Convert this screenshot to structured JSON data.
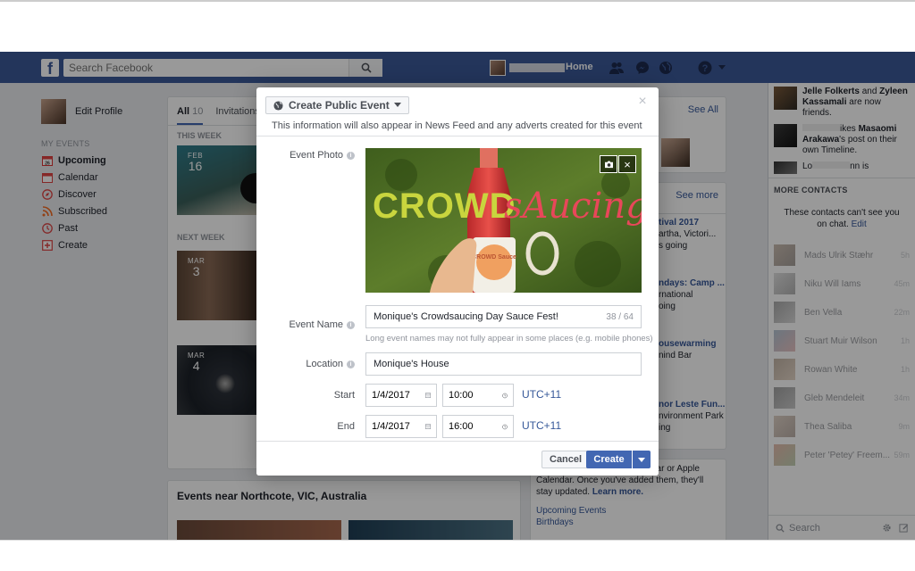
{
  "header": {
    "search_placeholder": "Search Facebook",
    "home": "Home"
  },
  "left_nav": {
    "edit_profile": "Edit Profile",
    "section": "MY EVENTS",
    "items": [
      {
        "label": "Upcoming",
        "icon": "calendar-26-icon"
      },
      {
        "label": "Calendar",
        "icon": "calendar-icon"
      },
      {
        "label": "Discover",
        "icon": "compass-icon"
      },
      {
        "label": "Subscribed",
        "icon": "rss-icon"
      },
      {
        "label": "Past",
        "icon": "clock-icon"
      },
      {
        "label": "Create",
        "icon": "plus-box-icon"
      }
    ],
    "calendar_day": "26"
  },
  "events": {
    "tab_all": "All",
    "tab_all_count": "10",
    "tab_invitations": "Invitations",
    "this_week": "THIS WEEK",
    "next_week": "NEXT WEEK",
    "cards": [
      {
        "month": "FEB",
        "day": "16"
      },
      {
        "month": "MAR",
        "day": "3"
      },
      {
        "month": "MAR",
        "day": "4"
      }
    ],
    "nearby_title": "Events near Northcote, VIC, Australia"
  },
  "right": {
    "see_all": "See All",
    "see_more": "See more",
    "snippets": [
      {
        "title": "tival 2017",
        "line1": "artha, Victori...",
        "line2": "s going"
      },
      {
        "title": "ndays: Camp ...",
        "line1": "rnational",
        "line2": "oing"
      },
      {
        "title": "ousewarming",
        "line1": "nind Bar",
        "line2": ""
      },
      {
        "title": "nor Leste Fun...",
        "line1": "nvironment Park",
        "line2": "ing"
      }
    ],
    "export_text": "rosoft Outlook, Google Calendar or Apple Calendar. Once you've added them, they'll stay updated.",
    "learn_more": "Learn more.",
    "upcoming_events": "Upcoming Events",
    "birthdays": "Birthdays"
  },
  "chat": {
    "notifs": [
      {
        "bold1": "Jelle Folkerts",
        "mid": " and ",
        "bold2": "Zyleen Kassamali",
        "rest": " are now friends."
      },
      {
        "bold1": "",
        "mid": "ikes ",
        "bold2": "Masaomi Arakawa",
        "rest": "'s post on their own Timeline."
      },
      {
        "bold1": "",
        "mid": "Lo",
        "bold2": "",
        "rest": "nn is"
      }
    ],
    "more_contacts": "MORE CONTACTS",
    "cant_see": "These contacts can't see you on chat.",
    "edit": "Edit",
    "contacts": [
      {
        "name": "Mads Ulrik Stæhr",
        "time": "5h"
      },
      {
        "name": "Niku Will Iams",
        "time": "45m"
      },
      {
        "name": "Ben Vella",
        "time": "22m"
      },
      {
        "name": "Stuart Muir Wilson",
        "time": "1h"
      },
      {
        "name": "Rowan White",
        "time": "1h"
      },
      {
        "name": "Gleb Mendeleit",
        "time": "34m"
      },
      {
        "name": "Thea Saliba",
        "time": "9m"
      },
      {
        "name": "Peter 'Petey' Freem...",
        "time": "59m"
      }
    ],
    "search": "Search"
  },
  "modal": {
    "title": "Create Public Event",
    "note": "This information will also appear in News Feed and any adverts created for this event",
    "photo_label": "Event Photo",
    "photo_text_1": "CROWD",
    "photo_text_2": "sAucing",
    "bottle_text": "CROWD Sauce",
    "name_label": "Event Name",
    "name_value": "Monique's Crowdsaucing Day Sauce Fest!",
    "name_counter": "38 / 64",
    "name_hint": "Long event names may not fully appear in some places (e.g. mobile phones)",
    "location_label": "Location",
    "location_value": "Monique's House",
    "start_label": "Start",
    "start_date": "1/4/2017",
    "start_time": "10:00",
    "end_label": "End",
    "end_date": "1/4/2017",
    "end_time": "16:00",
    "timezone": "UTC+11",
    "cancel": "Cancel",
    "create": "Create"
  },
  "colors": {
    "fb_blue": "#3b5998",
    "button_blue": "#4267b2",
    "link": "#365899"
  }
}
